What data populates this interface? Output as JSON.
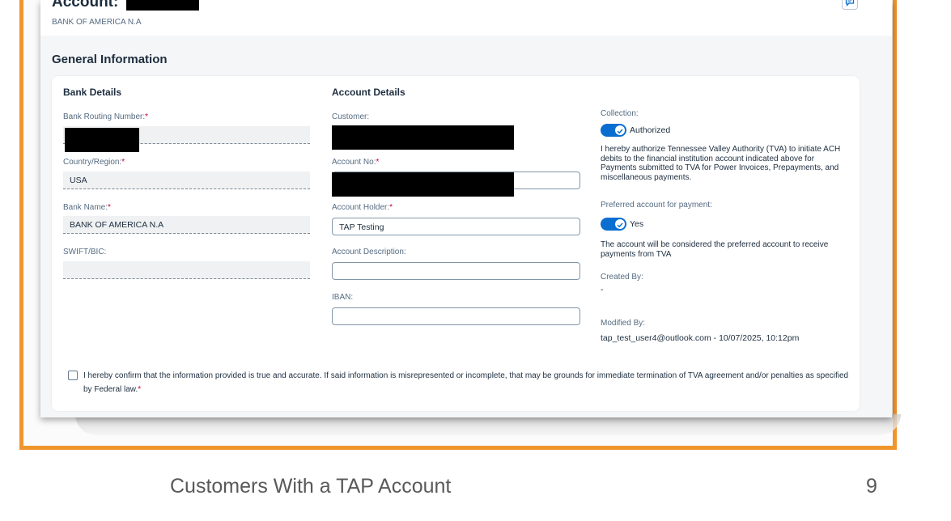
{
  "header": {
    "title": "Account:",
    "subtitle": "BANK OF AMERICA N.A"
  },
  "section_title": "General Information",
  "bank_details": {
    "title": "Bank Details",
    "routing_label": "Bank Routing Number:",
    "country_label": "Country/Region:",
    "country_value": "USA",
    "bank_name_label": "Bank Name:",
    "bank_name_value": "BANK OF AMERICA N.A",
    "swift_label": "SWIFT/BIC:"
  },
  "account_details": {
    "title": "Account Details",
    "customer_label": "Customer:",
    "account_no_label": "Account No:",
    "holder_label": "Account Holder:",
    "holder_value": "TAP Testing",
    "description_label": "Account Description:",
    "iban_label": "IBAN:"
  },
  "right_column": {
    "collection_label": "Collection:",
    "collection_toggle": "Authorized",
    "collection_text": "I hereby authorize Tennessee Valley Authority (TVA) to initiate ACH debits to the financial institution account indicated above for Payments submitted to TVA for Power Invoices, Prepayments, and miscellaneous payments.",
    "preferred_label": "Preferred account for payment:",
    "preferred_toggle": "Yes",
    "preferred_text": "The account will be considered the preferred account to receive payments from TVA",
    "created_label": "Created By:",
    "created_value": "-",
    "modified_label": "Modified By:",
    "modified_value": "tap_test_user4@outlook.com - 10/07/2025, 10:12pm"
  },
  "confirmation": "I hereby confirm that the information provided is true and accurate. If said information is misrepresented or incomplete, that may be grounds for immediate termination of TVA agreement and/or penalties as specified by Federal law.",
  "required_mark": "*",
  "footer": {
    "caption": "Customers With a TAP Account",
    "page_number": "9"
  },
  "colors": {
    "frame": "#f0952c",
    "toggle": "#0a6ed1",
    "required": "#c0003a"
  }
}
